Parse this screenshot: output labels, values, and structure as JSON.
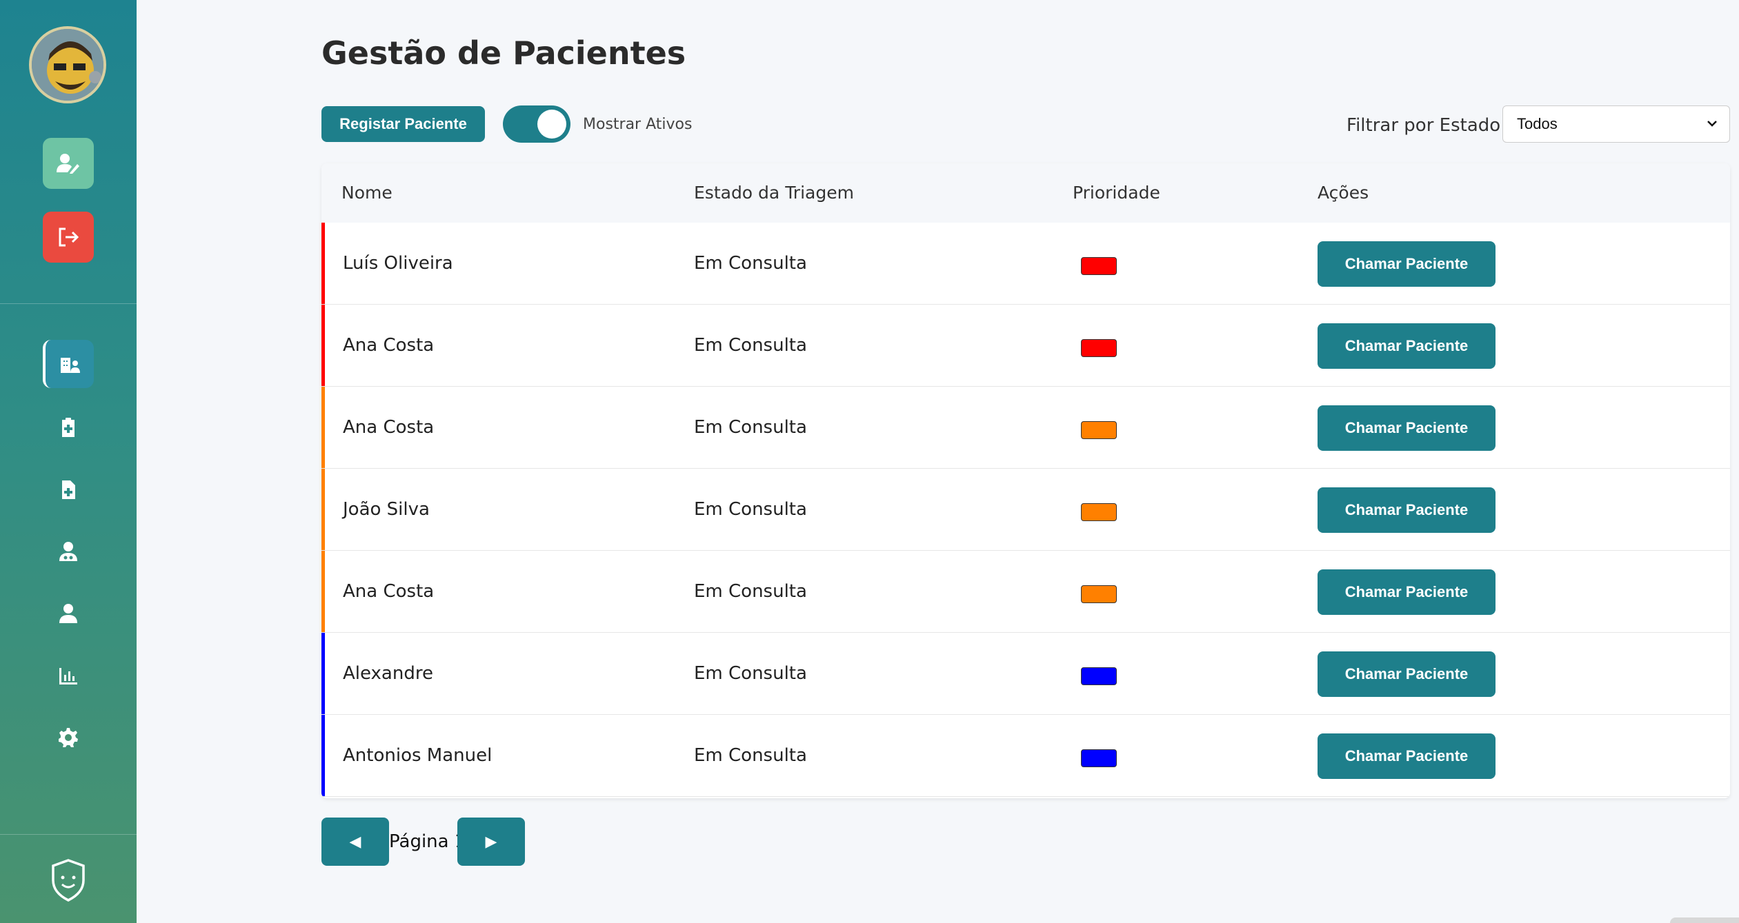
{
  "sidebar": {
    "avatar_icon": "user-avatar",
    "edit_icon": "user-edit-icon",
    "logout_icon": "logout-icon",
    "nav": [
      {
        "icon": "hospital-user-icon",
        "active": true
      },
      {
        "icon": "clipboard-medical-icon",
        "active": false
      },
      {
        "icon": "file-medical-icon",
        "active": false
      },
      {
        "icon": "user-doctor-icon",
        "active": false
      },
      {
        "icon": "user-icon",
        "active": false
      },
      {
        "icon": "chart-bar-icon",
        "active": false
      },
      {
        "icon": "gear-icon",
        "active": false
      }
    ],
    "logo_icon": "app-logo-icon"
  },
  "header": {
    "title": "Gestão de Pacientes",
    "register_button": "Registar Paciente",
    "toggle_label": "Mostrar Ativos",
    "toggle_on": true,
    "filter_label": "Filtrar por Estado:",
    "filter_value": "Todos"
  },
  "table": {
    "columns": [
      "Nome",
      "Estado da Triagem",
      "Prioridade",
      "Ações"
    ],
    "rows": [
      {
        "name": "Luís Oliveira",
        "status": "Em Consulta",
        "priority_color": "#ff0000",
        "action": "Chamar Paciente"
      },
      {
        "name": "Ana Costa",
        "status": "Em Consulta",
        "priority_color": "#ff0000",
        "action": "Chamar Paciente"
      },
      {
        "name": "Ana Costa",
        "status": "Em Consulta",
        "priority_color": "#ff8000",
        "action": "Chamar Paciente"
      },
      {
        "name": "João Silva",
        "status": "Em Consulta",
        "priority_color": "#ff8000",
        "action": "Chamar Paciente"
      },
      {
        "name": "Ana Costa",
        "status": "Em Consulta",
        "priority_color": "#ff8000",
        "action": "Chamar Paciente"
      },
      {
        "name": "Alexandre",
        "status": "Em Consulta",
        "priority_color": "#0000ff",
        "action": "Chamar Paciente"
      },
      {
        "name": "Antonios Manuel",
        "status": "Em Consulta",
        "priority_color": "#0000ff",
        "action": "Chamar Paciente"
      }
    ]
  },
  "pagination": {
    "prev_symbol": "◀",
    "label": "Página 1",
    "next_symbol": "▶"
  },
  "colors": {
    "accent": "#1e7f8b",
    "danger": "#ea4a3f",
    "success": "#6ec4a4"
  }
}
